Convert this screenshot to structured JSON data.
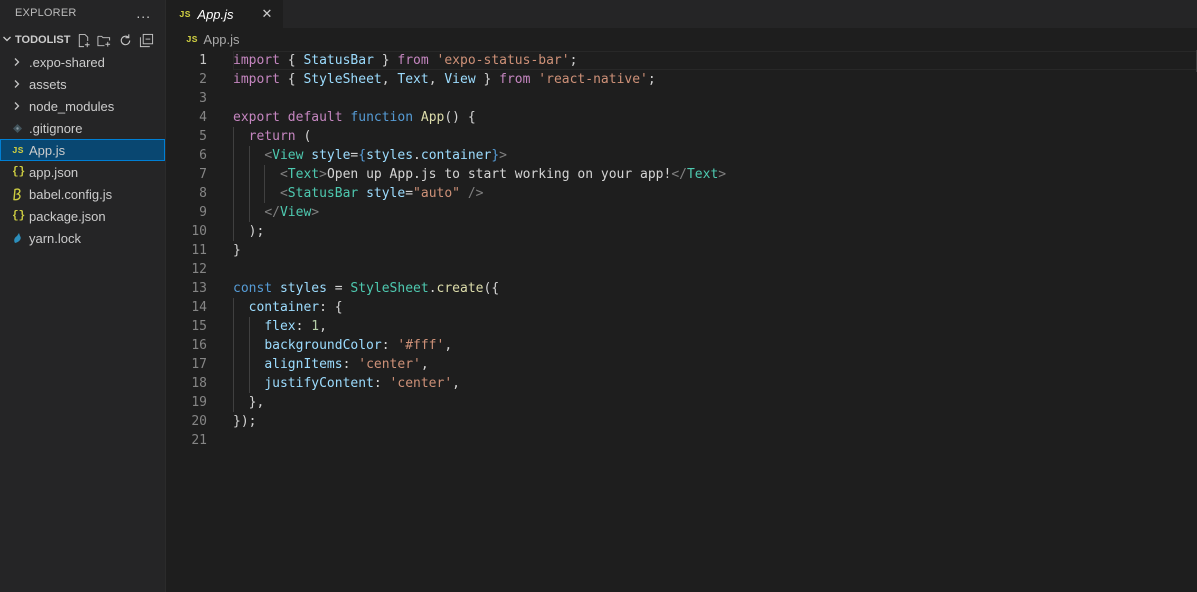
{
  "sidebar": {
    "title": "EXPLORER",
    "more_icon": "...",
    "section": "TODOLIST",
    "actions": [
      "new-file-icon",
      "new-folder-icon",
      "refresh-icon",
      "collapse-all-icon"
    ],
    "items": [
      {
        "label": ".expo-shared",
        "kind": "folder",
        "icon": "chevron-right-icon"
      },
      {
        "label": "assets",
        "kind": "folder",
        "icon": "chevron-right-icon"
      },
      {
        "label": "node_modules",
        "kind": "folder",
        "icon": "chevron-right-icon"
      },
      {
        "label": ".gitignore",
        "kind": "file",
        "icon": "git-icon"
      },
      {
        "label": "App.js",
        "kind": "file",
        "icon": "js-icon",
        "selected": true
      },
      {
        "label": "app.json",
        "kind": "file",
        "icon": "json-icon"
      },
      {
        "label": "babel.config.js",
        "kind": "file",
        "icon": "babel-icon"
      },
      {
        "label": "package.json",
        "kind": "file",
        "icon": "json-icon"
      },
      {
        "label": "yarn.lock",
        "kind": "file",
        "icon": "yarn-icon"
      }
    ]
  },
  "editor": {
    "tab": {
      "label": "App.js",
      "icon_text": "JS",
      "close": "✕"
    },
    "breadcrumb": {
      "icon_text": "JS",
      "label": "App.js"
    },
    "active_line": 1,
    "lines": [
      [
        [
          "kw",
          "import"
        ],
        [
          "p",
          " { "
        ],
        [
          "var",
          "StatusBar"
        ],
        [
          "p",
          " } "
        ],
        [
          "kw",
          "from"
        ],
        [
          "p",
          " "
        ],
        [
          "str",
          "'expo-status-bar'"
        ],
        [
          "p",
          ";"
        ]
      ],
      [
        [
          "kw",
          "import"
        ],
        [
          "p",
          " { "
        ],
        [
          "var",
          "StyleSheet"
        ],
        [
          "p",
          ", "
        ],
        [
          "var",
          "Text"
        ],
        [
          "p",
          ", "
        ],
        [
          "var",
          "View"
        ],
        [
          "p",
          " } "
        ],
        [
          "kw",
          "from"
        ],
        [
          "p",
          " "
        ],
        [
          "str",
          "'react-native'"
        ],
        [
          "p",
          ";"
        ]
      ],
      [],
      [
        [
          "kw",
          "export"
        ],
        [
          "p",
          " "
        ],
        [
          "kw",
          "default"
        ],
        [
          "p",
          " "
        ],
        [
          "st",
          "function"
        ],
        [
          "p",
          " "
        ],
        [
          "fn",
          "App"
        ],
        [
          "p",
          "() {"
        ]
      ],
      [
        [
          "p",
          "  "
        ],
        [
          "kw",
          "return"
        ],
        [
          "p",
          " ("
        ]
      ],
      [
        [
          "p",
          "    "
        ],
        [
          "tag",
          "<"
        ],
        [
          "ty",
          "View"
        ],
        [
          "p",
          " "
        ],
        [
          "var",
          "style"
        ],
        [
          "p",
          "="
        ],
        [
          "st",
          "{"
        ],
        [
          "var",
          "styles"
        ],
        [
          "p",
          "."
        ],
        [
          "var",
          "container"
        ],
        [
          "st",
          "}"
        ],
        [
          "tag",
          ">"
        ]
      ],
      [
        [
          "p",
          "      "
        ],
        [
          "tag",
          "<"
        ],
        [
          "ty",
          "Text"
        ],
        [
          "tag",
          ">"
        ],
        [
          "jsx",
          "Open up App.js to start working on your app!"
        ],
        [
          "tag",
          "</"
        ],
        [
          "ty",
          "Text"
        ],
        [
          "tag",
          ">"
        ]
      ],
      [
        [
          "p",
          "      "
        ],
        [
          "tag",
          "<"
        ],
        [
          "ty",
          "StatusBar"
        ],
        [
          "p",
          " "
        ],
        [
          "var",
          "style"
        ],
        [
          "p",
          "="
        ],
        [
          "str",
          "\"auto\""
        ],
        [
          "p",
          " "
        ],
        [
          "tag",
          "/>"
        ]
      ],
      [
        [
          "p",
          "    "
        ],
        [
          "tag",
          "</"
        ],
        [
          "ty",
          "View"
        ],
        [
          "tag",
          ">"
        ]
      ],
      [
        [
          "p",
          "  );"
        ]
      ],
      [
        [
          "p",
          "}"
        ]
      ],
      [],
      [
        [
          "st",
          "const"
        ],
        [
          "p",
          " "
        ],
        [
          "var",
          "styles"
        ],
        [
          "p",
          " = "
        ],
        [
          "ty",
          "StyleSheet"
        ],
        [
          "p",
          "."
        ],
        [
          "fn",
          "create"
        ],
        [
          "p",
          "({"
        ]
      ],
      [
        [
          "p",
          "  "
        ],
        [
          "var",
          "container"
        ],
        [
          "p",
          ": {"
        ]
      ],
      [
        [
          "p",
          "    "
        ],
        [
          "var",
          "flex"
        ],
        [
          "p",
          ": "
        ],
        [
          "num",
          "1"
        ],
        [
          "p",
          ","
        ]
      ],
      [
        [
          "p",
          "    "
        ],
        [
          "var",
          "backgroundColor"
        ],
        [
          "p",
          ": "
        ],
        [
          "str",
          "'#fff'"
        ],
        [
          "p",
          ","
        ]
      ],
      [
        [
          "p",
          "    "
        ],
        [
          "var",
          "alignItems"
        ],
        [
          "p",
          ": "
        ],
        [
          "str",
          "'center'"
        ],
        [
          "p",
          ","
        ]
      ],
      [
        [
          "p",
          "    "
        ],
        [
          "var",
          "justifyContent"
        ],
        [
          "p",
          ": "
        ],
        [
          "str",
          "'center'"
        ],
        [
          "p",
          ","
        ]
      ],
      [
        [
          "p",
          "  },"
        ]
      ],
      [
        [
          "p",
          "});"
        ]
      ],
      []
    ]
  },
  "colors": {
    "background": "#1e1e1e",
    "sidebar": "#252526",
    "selection": "#094771",
    "keyword": "#c586c0",
    "storage": "#569cd6",
    "type": "#4ec9b0",
    "function": "#dcdcaa",
    "variable": "#9cdcfe",
    "string": "#ce9178",
    "number": "#b5cea8"
  }
}
